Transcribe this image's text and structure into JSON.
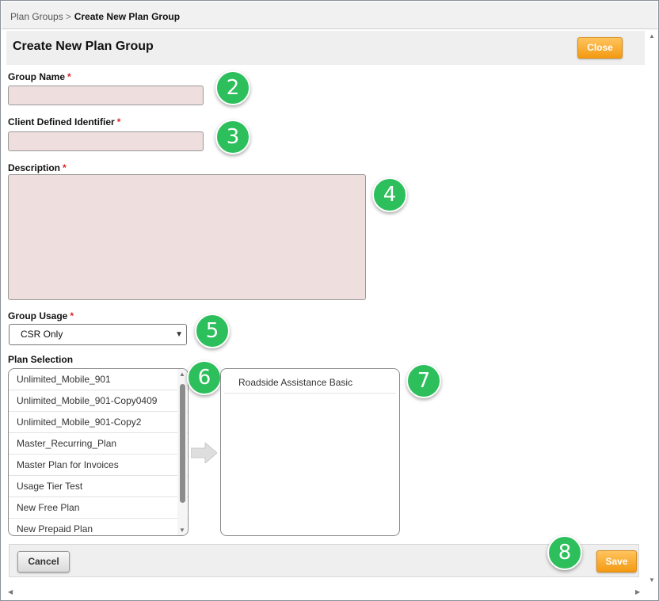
{
  "breadcrumb": {
    "parent": "Plan Groups",
    "separator": ">",
    "current": "Create New Plan Group"
  },
  "header": {
    "title": "Create New Plan Group",
    "close_label": "Close"
  },
  "form": {
    "group_name": {
      "label": "Group Name",
      "required_mark": "*",
      "value": ""
    },
    "client_identifier": {
      "label": "Client Defined Identifier",
      "required_mark": "*",
      "value": ""
    },
    "description": {
      "label": "Description",
      "required_mark": "*",
      "value": ""
    },
    "group_usage": {
      "label": "Group Usage",
      "required_mark": "*",
      "selected": "CSR Only"
    },
    "plan_selection": {
      "label": "Plan Selection",
      "available": [
        "Unlimited_Mobile_901",
        "Unlimited_Mobile_901-Copy0409",
        "Unlimited_Mobile_901-Copy2",
        "Master_Recurring_Plan",
        "Master Plan for Invoices",
        "Usage Tier Test",
        "New Free Plan",
        "New Prepaid Plan"
      ],
      "selected": [
        "Roadside Assistance Basic"
      ]
    }
  },
  "badges": [
    "2",
    "3",
    "4",
    "5",
    "6",
    "7",
    "8"
  ],
  "footer": {
    "cancel_label": "Cancel",
    "save_label": "Save"
  },
  "colors": {
    "accent": "#f39a12",
    "required": "#e02020",
    "badge": "#2dbf5c",
    "input_fill": "#eedede"
  }
}
